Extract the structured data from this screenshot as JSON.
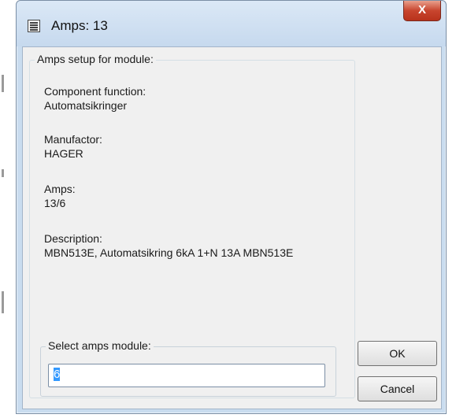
{
  "window": {
    "title": "Amps: 13",
    "close_glyph": "X"
  },
  "setup_group": {
    "label": "Amps setup for module:",
    "component_function": {
      "label": "Component function:",
      "value": "Automatsikringer"
    },
    "manufacturer": {
      "label": "Manufactor:",
      "value": "HAGER"
    },
    "amps": {
      "label": "Amps:",
      "value": "13/6"
    },
    "description": {
      "label": "Description:",
      "value": "MBN513E, Automatsikring 6kA 1+N 13A MBN513E"
    }
  },
  "select_group": {
    "label": "Select amps module:",
    "input_value": "6"
  },
  "buttons": {
    "ok": "OK",
    "cancel": "Cancel"
  },
  "colors": {
    "titlebar": "#c9dcef",
    "close": "#c8452e",
    "selection": "#3399ff"
  }
}
